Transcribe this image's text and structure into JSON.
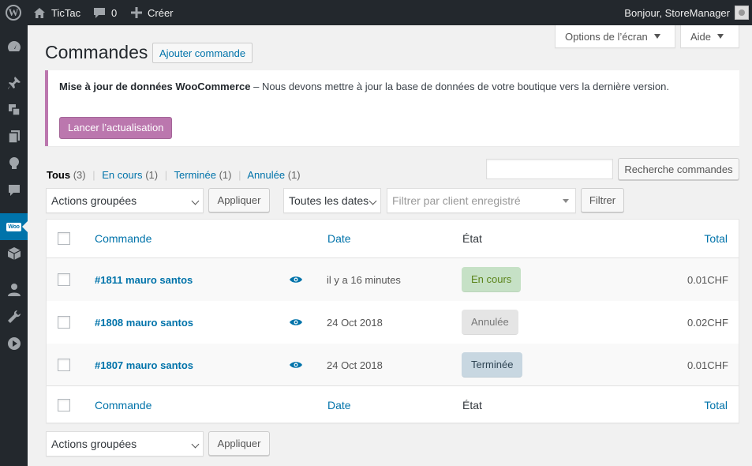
{
  "adminbar": {
    "site_name": "TicTac",
    "comments_count": "0",
    "new_label": "Créer",
    "greeting": "Bonjour, StoreManager"
  },
  "sidemenu": {
    "icons": [
      "dashboard-icon",
      "pin-icon",
      "media-icon",
      "pages-icon",
      "lightbulb-icon",
      "comments-icon",
      "woocommerce-icon",
      "products-icon",
      "users-icon",
      "tools-icon",
      "play-icon"
    ],
    "woo_badge": "Woo"
  },
  "screen_meta": {
    "screen_options": "Options de l’écran",
    "help": "Aide"
  },
  "heading": {
    "title": "Commandes",
    "add_new": "Ajouter commande"
  },
  "notice": {
    "strong": "Mise à jour de données WooCommerce",
    "dash": " – ",
    "text": "Nous devons mettre à jour la base de données de votre boutique vers la dernière version.",
    "button": "Lancer l’actualisation",
    "accent": "#bb77ae"
  },
  "views": [
    {
      "label": "Tous",
      "count": "(3)"
    },
    {
      "label": "En cours",
      "count": "(1)"
    },
    {
      "label": "Terminée",
      "count": "(1)"
    },
    {
      "label": "Annulée",
      "count": "(1)"
    }
  ],
  "search": {
    "value": "",
    "button": "Recherche commandes"
  },
  "filters": {
    "bulk_actions": "Actions groupées",
    "apply": "Appliquer",
    "dates": "Toutes les dates",
    "customer_placeholder": "Filtrer par client enregistré",
    "filter": "Filtrer"
  },
  "table": {
    "columns": {
      "order": "Commande",
      "date": "Date",
      "status": "État",
      "total": "Total"
    },
    "rows": [
      {
        "order": "#1811 mauro santos",
        "date": "il y a 16 minutes",
        "status": "En cours",
        "status_key": "processing",
        "total": "0.01CHF"
      },
      {
        "order": "#1808 mauro santos",
        "date": "24 Oct 2018",
        "status": "Annulée",
        "status_key": "cancelled",
        "total": "0.02CHF"
      },
      {
        "order": "#1807 mauro santos",
        "date": "24 Oct 2018",
        "status": "Terminée",
        "status_key": "completed",
        "total": "0.01CHF"
      }
    ]
  },
  "status_colors": {
    "processing": {
      "bg": "#c6e1c6",
      "fg": "#5b841b"
    },
    "cancelled": {
      "bg": "#e5e5e5",
      "fg": "#777777"
    },
    "completed": {
      "bg": "#c8d7e1",
      "fg": "#2e4453"
    }
  }
}
